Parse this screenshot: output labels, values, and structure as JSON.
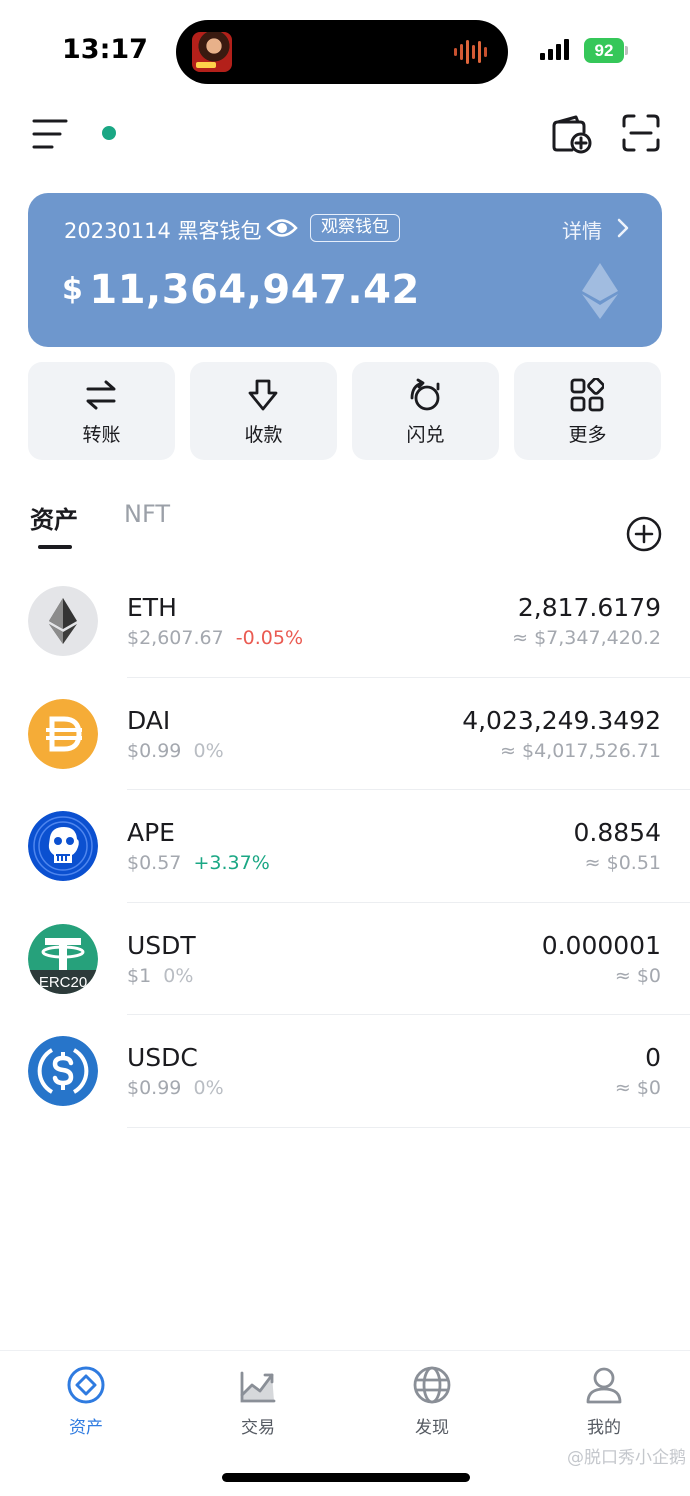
{
  "status_bar": {
    "time": "13:17",
    "battery": "92"
  },
  "wallet": {
    "name": "20230114 黑客钱包",
    "watch_badge": "观察钱包",
    "detail_label": "详情",
    "currency_symbol": "$",
    "balance": "11,364,947.42",
    "card_color": "#6e97cd"
  },
  "actions": [
    {
      "label": "转账",
      "icon": "transfer-icon"
    },
    {
      "label": "收款",
      "icon": "receive-icon"
    },
    {
      "label": "闪兑",
      "icon": "swap-icon"
    },
    {
      "label": "更多",
      "icon": "more-icon"
    }
  ],
  "tabs": [
    {
      "label": "资产",
      "active": true
    },
    {
      "label": "NFT",
      "active": false
    }
  ],
  "assets": [
    {
      "symbol": "ETH",
      "price": "$2,607.67",
      "change": "-0.05%",
      "trend": "neg",
      "amount": "2,817.6179",
      "value": "≈ $7,347,420.2",
      "icon": "eth-logo-icon"
    },
    {
      "symbol": "DAI",
      "price": "$0.99",
      "change": "0%",
      "trend": "flat",
      "amount": "4,023,249.3492",
      "value": "≈ $4,017,526.71",
      "icon": "dai-logo-icon"
    },
    {
      "symbol": "APE",
      "price": "$0.57",
      "change": "+3.37%",
      "trend": "pos",
      "amount": "0.8854",
      "value": "≈ $0.51",
      "icon": "ape-logo-icon"
    },
    {
      "symbol": "USDT",
      "price": "$1",
      "change": "0%",
      "trend": "flat",
      "amount": "0.000001",
      "value": "≈ $0",
      "icon": "usdt-logo-icon",
      "badge": "ERC20"
    },
    {
      "symbol": "USDC",
      "price": "$0.99",
      "change": "0%",
      "trend": "flat",
      "amount": "0",
      "value": "≈ $0",
      "icon": "usdc-logo-icon"
    }
  ],
  "bottom_nav": [
    {
      "label": "资产",
      "active": true,
      "icon": "assets-icon"
    },
    {
      "label": "交易",
      "active": false,
      "icon": "trade-icon"
    },
    {
      "label": "发现",
      "active": false,
      "icon": "discover-icon"
    },
    {
      "label": "我的",
      "active": false,
      "icon": "profile-icon"
    }
  ],
  "watermark": "@脱口秀小企鹅",
  "colors": {
    "accent": "#2f7be0",
    "positive": "#1aa784",
    "negative": "#ea5b52"
  }
}
